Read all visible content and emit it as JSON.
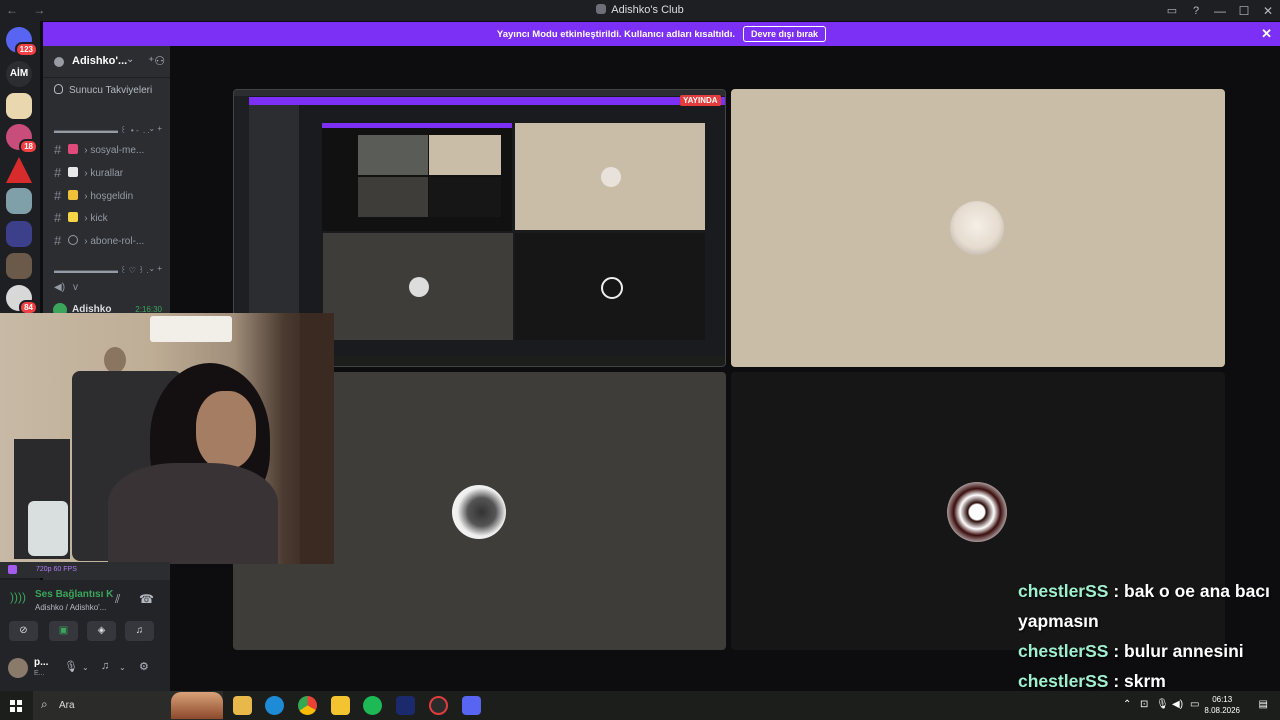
{
  "window": {
    "title": "Adishko's Club",
    "nav_glyph": "← →",
    "controls": [
      "—",
      "☐",
      "✕"
    ]
  },
  "servers": {
    "dm_badge": "123",
    "aim_label": "AİM",
    "badge_18": "18",
    "badge_84": "84"
  },
  "banner": {
    "text": "Yayıncı Modu etkinleştirildi. Kullanıcı adları kısaltıldı.",
    "button": "Devre dışı bırak",
    "close": "✕"
  },
  "sidebar": {
    "server_name": "Adishko'...",
    "boosts": "Sunucu Takviyeleri",
    "category1": "▬▬▬▬▬▬▬▬ ⁠꒰ ⁠⁠ ⁠• ⁠- ⁠ ⁠. ⁠.",
    "category2": "▬▬▬▬▬▬▬▬ ⁠꒰⁠ ⁠♡ ⁠꒱ ⁠.",
    "channels": [
      {
        "label": "›  sosyal-me...",
        "emoji_color": "#e04a7a"
      },
      {
        "label": "›  kurallar",
        "emoji_color": "#e8e8e8"
      },
      {
        "label": "›  hoşgeldin",
        "emoji_color": "#f0c03a"
      },
      {
        "label": "›  kick",
        "emoji_color": "#f5d547"
      },
      {
        "label": "›  abone-rol-...",
        "emoji_color": "#2b2d31"
      }
    ],
    "voice_channel": "v",
    "voice_user": "Adishko",
    "voice_time": "2:16:30"
  },
  "stream_quality": "720p 60 FPS",
  "rtc": {
    "status": "Ses Bağlantısı K",
    "location": "Adishko / Adishko'..."
  },
  "user": {
    "name": "p...",
    "status": "E..."
  },
  "nested_preview": {
    "live_badge": "YAYINDA"
  },
  "chat": [
    {
      "user": "chestlerSS",
      "sep": " : ",
      "text": "bak o oe ana bacı yapmasın"
    },
    {
      "user": "chestlerSS",
      "sep": " : ",
      "text": "bulur annesini"
    },
    {
      "user": "chestlerSS",
      "sep": " : ",
      "text": "skrm"
    }
  ],
  "taskbar": {
    "search": "Ara",
    "time": "06:13",
    "date": "8.08.2026"
  },
  "colors": {
    "accent_banner": "#7c2ff5",
    "voice_green": "#3ba55c",
    "chat_user": "#9ff0cf"
  }
}
